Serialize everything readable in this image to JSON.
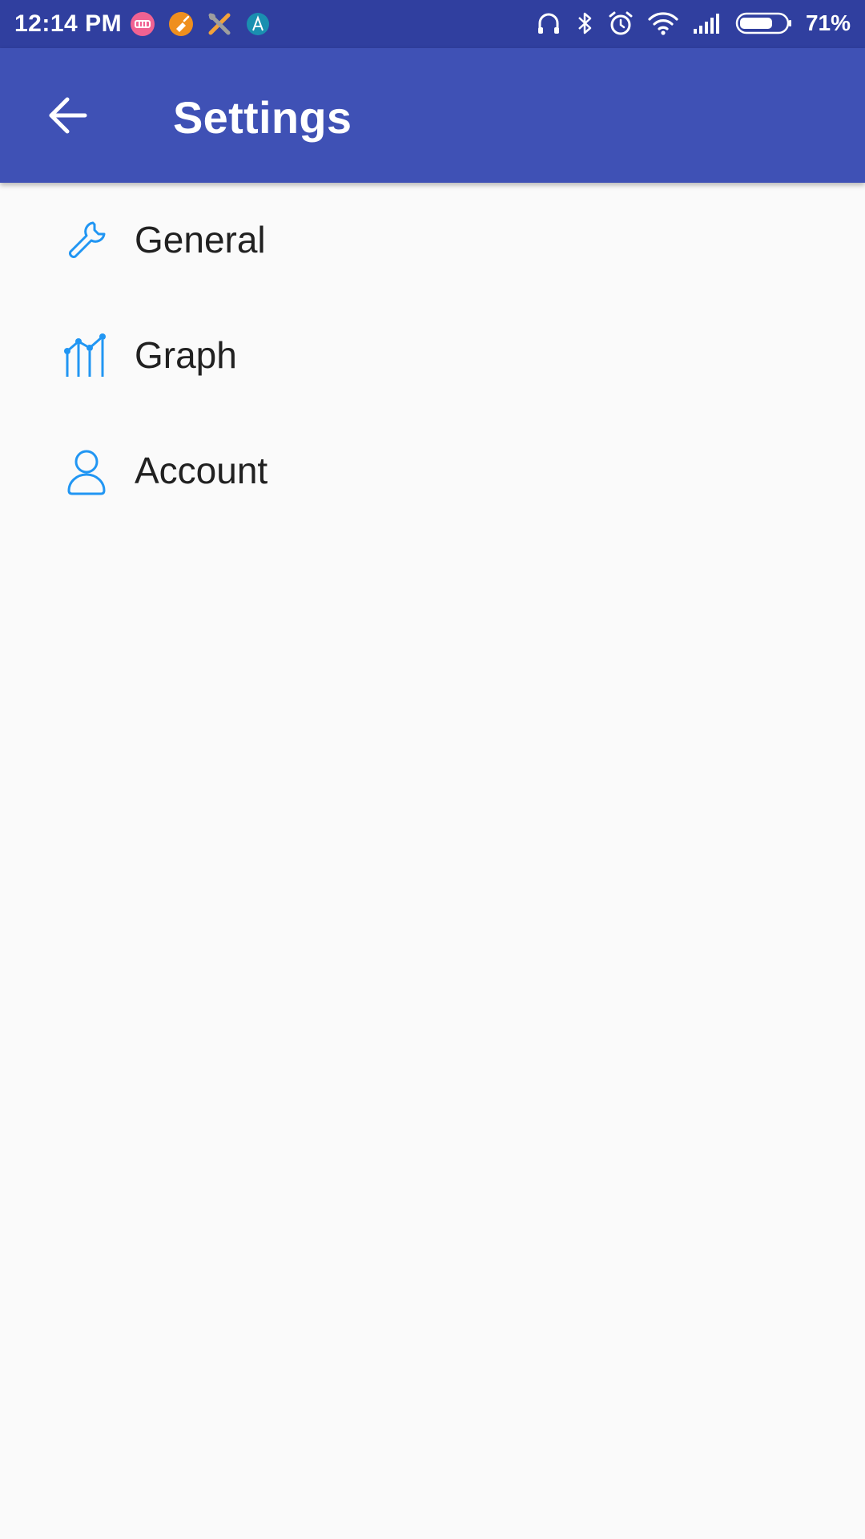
{
  "status_bar": {
    "time": "12:14 PM",
    "battery_percent": "71%",
    "battery_level": 0.71,
    "notification_icons": [
      "app-icon-pink",
      "app-icon-orange",
      "tools-icon",
      "app-icon-teal"
    ],
    "system_icons": [
      "headset-icon",
      "bluetooth-icon",
      "alarm-icon",
      "wifi-icon",
      "signal-icon",
      "battery-icon"
    ]
  },
  "app_bar": {
    "title": "Settings",
    "back_icon": "arrow-back-icon"
  },
  "settings": {
    "items": [
      {
        "label": "General",
        "icon": "wrench-icon"
      },
      {
        "label": "Graph",
        "icon": "graph-icon"
      },
      {
        "label": "Account",
        "icon": "person-icon"
      }
    ]
  },
  "colors": {
    "status_bar": "#303f9f",
    "app_bar": "#3f51b5",
    "background": "#fafafa",
    "icon_accent": "#2196f3",
    "text_primary": "#212121"
  }
}
